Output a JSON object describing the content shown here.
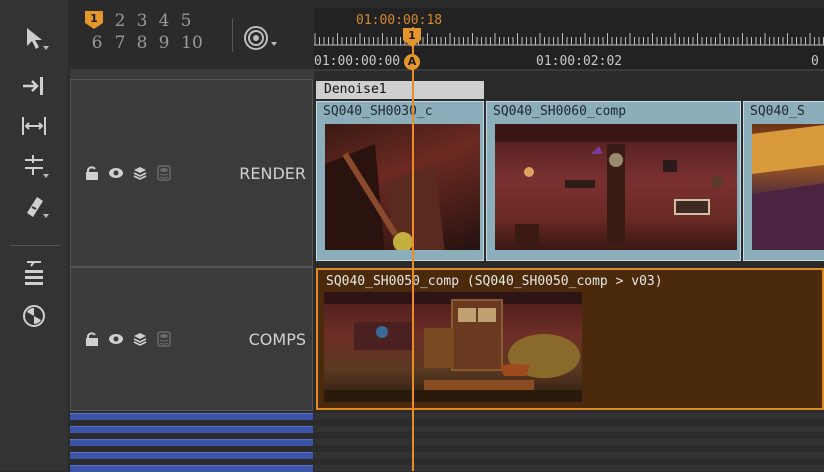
{
  "toolbar": {
    "tools": [
      "select-tool",
      "move-tool",
      "slip-tool",
      "roll-tool",
      "razor-tool",
      "slide-tool",
      "retime-tool"
    ]
  },
  "track_selector": {
    "row1": [
      "1",
      "2",
      "3",
      "4",
      "5"
    ],
    "row2": [
      "6",
      "7",
      "8",
      "9",
      "10"
    ],
    "active": "1"
  },
  "timeline": {
    "current_timecode": "01:00:00:18",
    "ruler_labels": [
      "01:00:00:00",
      "01:00:02:02",
      "0"
    ],
    "playhead_in_marker": "1",
    "playhead_out_marker": "A"
  },
  "tracks": [
    {
      "name": "RENDER",
      "clips": [
        {
          "title": "SQ040_SH0030_c"
        },
        {
          "title": "SQ040_SH0060_comp"
        },
        {
          "title": "SQ040_S"
        }
      ],
      "effect": "Denoise1"
    },
    {
      "name": "COMPS",
      "clips": [
        {
          "title": "SQ040_SH0050_comp (SQ040_SH0050_comp > v03)"
        }
      ]
    }
  ],
  "colors": {
    "playhead": "#e98d28",
    "render_clip": "#8cadba",
    "comp_clip": "#4a2a0b",
    "comp_clip_border": "#e08a22",
    "empty_track": "#3b54a8"
  }
}
